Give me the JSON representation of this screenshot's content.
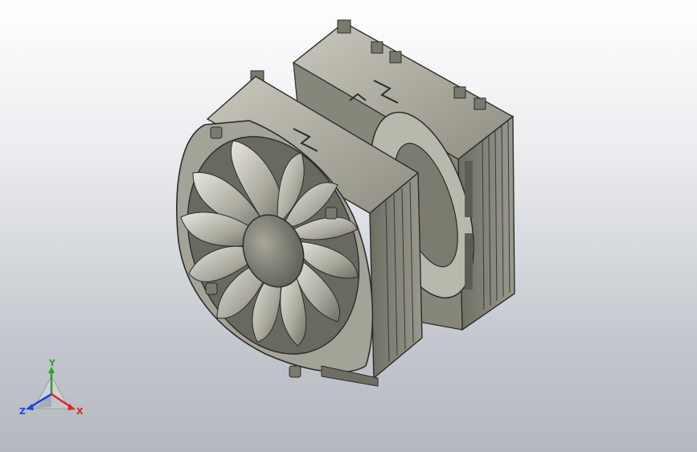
{
  "viewport": {
    "background_top": "#ffffff",
    "background_bottom": "#b3b8bf",
    "model_color": "#8d8c80",
    "edge_color": "#2c2c2a"
  },
  "model": {
    "icon": "cpu-cooler-model"
  },
  "triad": {
    "x_label": "X",
    "y_label": "Y",
    "z_label": "Z",
    "x_color": "#e02424",
    "y_color": "#2aa02a",
    "z_color": "#2040e0"
  }
}
